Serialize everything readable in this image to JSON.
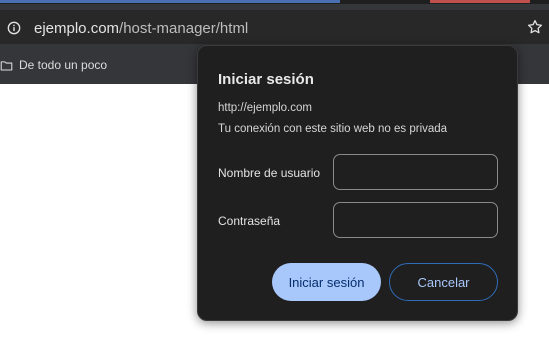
{
  "browser": {
    "url_host": "ejemplo.com",
    "url_path": "/host-manager/html",
    "site_info_icon": "info-icon",
    "bookmark_icon": "star-icon"
  },
  "bookmarks_bar": {
    "items": [
      {
        "label": "De todo un poco",
        "icon": "folder-icon"
      }
    ]
  },
  "auth_dialog": {
    "title": "Iniciar sesión",
    "origin": "http://ejemplo.com",
    "warning": "Tu conexión con este sitio web no es privada",
    "username_label": "Nombre de usuario",
    "username_value": "",
    "password_label": "Contraseña",
    "password_value": "",
    "submit_label": "Iniciar sesión",
    "cancel_label": "Cancelar"
  },
  "colors": {
    "primary_button": "#a8c7fa",
    "dialog_background": "#1f1f1f",
    "toolbar_background": "#35363a"
  }
}
